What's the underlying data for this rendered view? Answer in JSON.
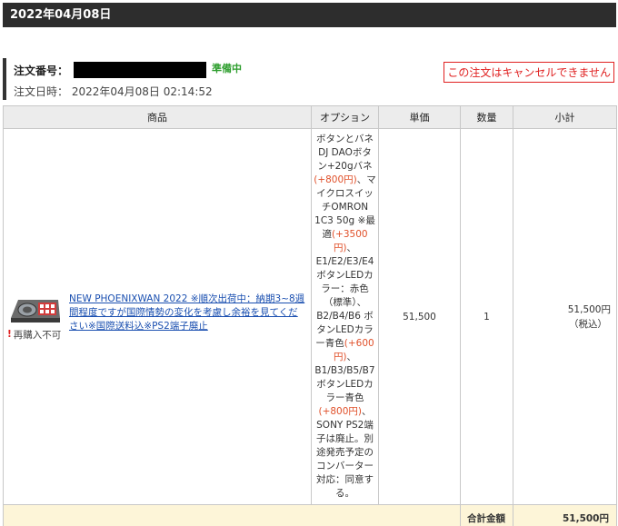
{
  "header": {
    "date": "2022年04月08日"
  },
  "order": {
    "number_label": "注文番号：",
    "status": "準備中",
    "date_label": "注文日時：",
    "date_value": "2022年04月08日 02:14:52",
    "cancel_note": "この注文はキャンセルできません"
  },
  "table": {
    "columns": [
      "商品",
      "オプション",
      "単価",
      "数量",
      "小計"
    ]
  },
  "item": {
    "name": "NEW PHOENIXWAN 2022 ※順次出荷中：納期3~8週間程度ですが国際情勢の変化を考慮し余裕を見てください※国際送料込※PS2端子廃止",
    "rebuy": "再購入不可",
    "options": [
      "ボタンとバネ",
      "DJ DAOボタン+20gバネ",
      "(+800円)",
      "、マイクロスイッチOMRON 1C3 50g ※最適",
      "(+3500円)",
      "、E1/E2/E3/E4ボタンLEDカラー：赤色（標準）、B2/B4/B6 ボタンLEDカラー青色",
      "(+600円)",
      "、B1/B3/B5/B7ボタンLEDカラー青色",
      "(+800円)",
      "、SONY PS2端子は廃止。別途発売予定のコンバーター対応：同意する。"
    ],
    "price": "51,500",
    "qty": "1",
    "subtotal": "51,500円",
    "subtotal_tax": "（税込）"
  },
  "total": {
    "label": "合計金額",
    "value": "51,500円"
  },
  "colors": {
    "header_bg": "#2d2d2d",
    "status": "#2e9e2e",
    "cancel": "#e02020",
    "total_bg": "#fdf5d8",
    "link": "#1a4fb0"
  }
}
